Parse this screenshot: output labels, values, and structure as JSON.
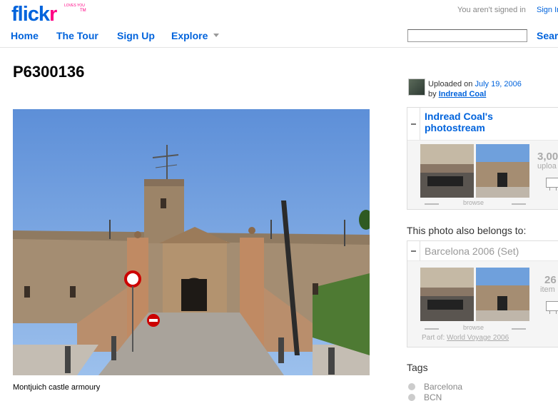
{
  "header": {
    "logo_text_main": "flick",
    "logo_text_accent": "r",
    "logo_tagline": "LOVES YOU",
    "logo_tm": "TM",
    "signed_status": "You aren't signed in",
    "signin_link": "Sign In",
    "nav": [
      "Home",
      "The Tour",
      "Sign Up",
      "Explore"
    ],
    "search_value": "",
    "search_button": "Search"
  },
  "photo": {
    "title": "P6300136",
    "caption": "Montjuich castle armoury"
  },
  "sidebar": {
    "uploaded_prefix": "Uploaded on",
    "uploaded_date": "July 19, 2006",
    "by_prefix": "by",
    "owner_name": "Indread Coal",
    "photostream_title": "Indread Coal's photostream",
    "photostream_count": "3,00",
    "photostream_unit": "uploa",
    "browse_label": "browse",
    "belongs_heading": "This photo also belongs to:",
    "set_title": "Barcelona 2006 (Set)",
    "set_count": "26",
    "set_unit": "item",
    "part_of_prefix": "Part of:",
    "part_of_link": "World Voyage 2006",
    "tags_heading": "Tags",
    "tags": [
      "Barcelona",
      "BCN"
    ]
  },
  "colors": {
    "brand_blue": "#0063dc",
    "brand_pink": "#ff0084"
  }
}
